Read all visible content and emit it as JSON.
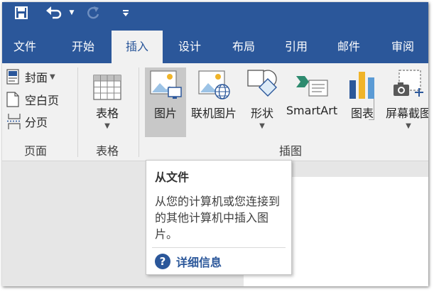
{
  "quick_access": {
    "save_icon": "save-icon",
    "undo_icon": "undo-icon",
    "redo_icon": "redo-icon",
    "customize_icon": "customize-toolbar-icon"
  },
  "tabs": [
    {
      "label": "文件",
      "active": false
    },
    {
      "label": "开始",
      "active": false
    },
    {
      "label": "插入",
      "active": true
    },
    {
      "label": "设计",
      "active": false
    },
    {
      "label": "布局",
      "active": false
    },
    {
      "label": "引用",
      "active": false
    },
    {
      "label": "邮件",
      "active": false
    },
    {
      "label": "审阅",
      "active": false
    }
  ],
  "ribbon": {
    "pages_group": {
      "label": "页面",
      "cover": "封面",
      "blank_page": "空白页",
      "page_break": "分页"
    },
    "tables_group": {
      "label": "表格",
      "table": "表格"
    },
    "illustrations_group": {
      "label": "插图",
      "picture": "图片",
      "online_picture": "联机图片",
      "shapes": "形状",
      "smartart": "SmartArt",
      "chart": "图表",
      "screenshot": "屏幕截图"
    }
  },
  "tooltip": {
    "title": "从文件",
    "body": "从您的计算机或您连接到的其他计算机中插入图片。",
    "link": "详细信息"
  },
  "colors": {
    "accent": "#2b579a",
    "ribbon_bg": "#f1f1f1",
    "hover_bg": "#c8c8c8"
  }
}
